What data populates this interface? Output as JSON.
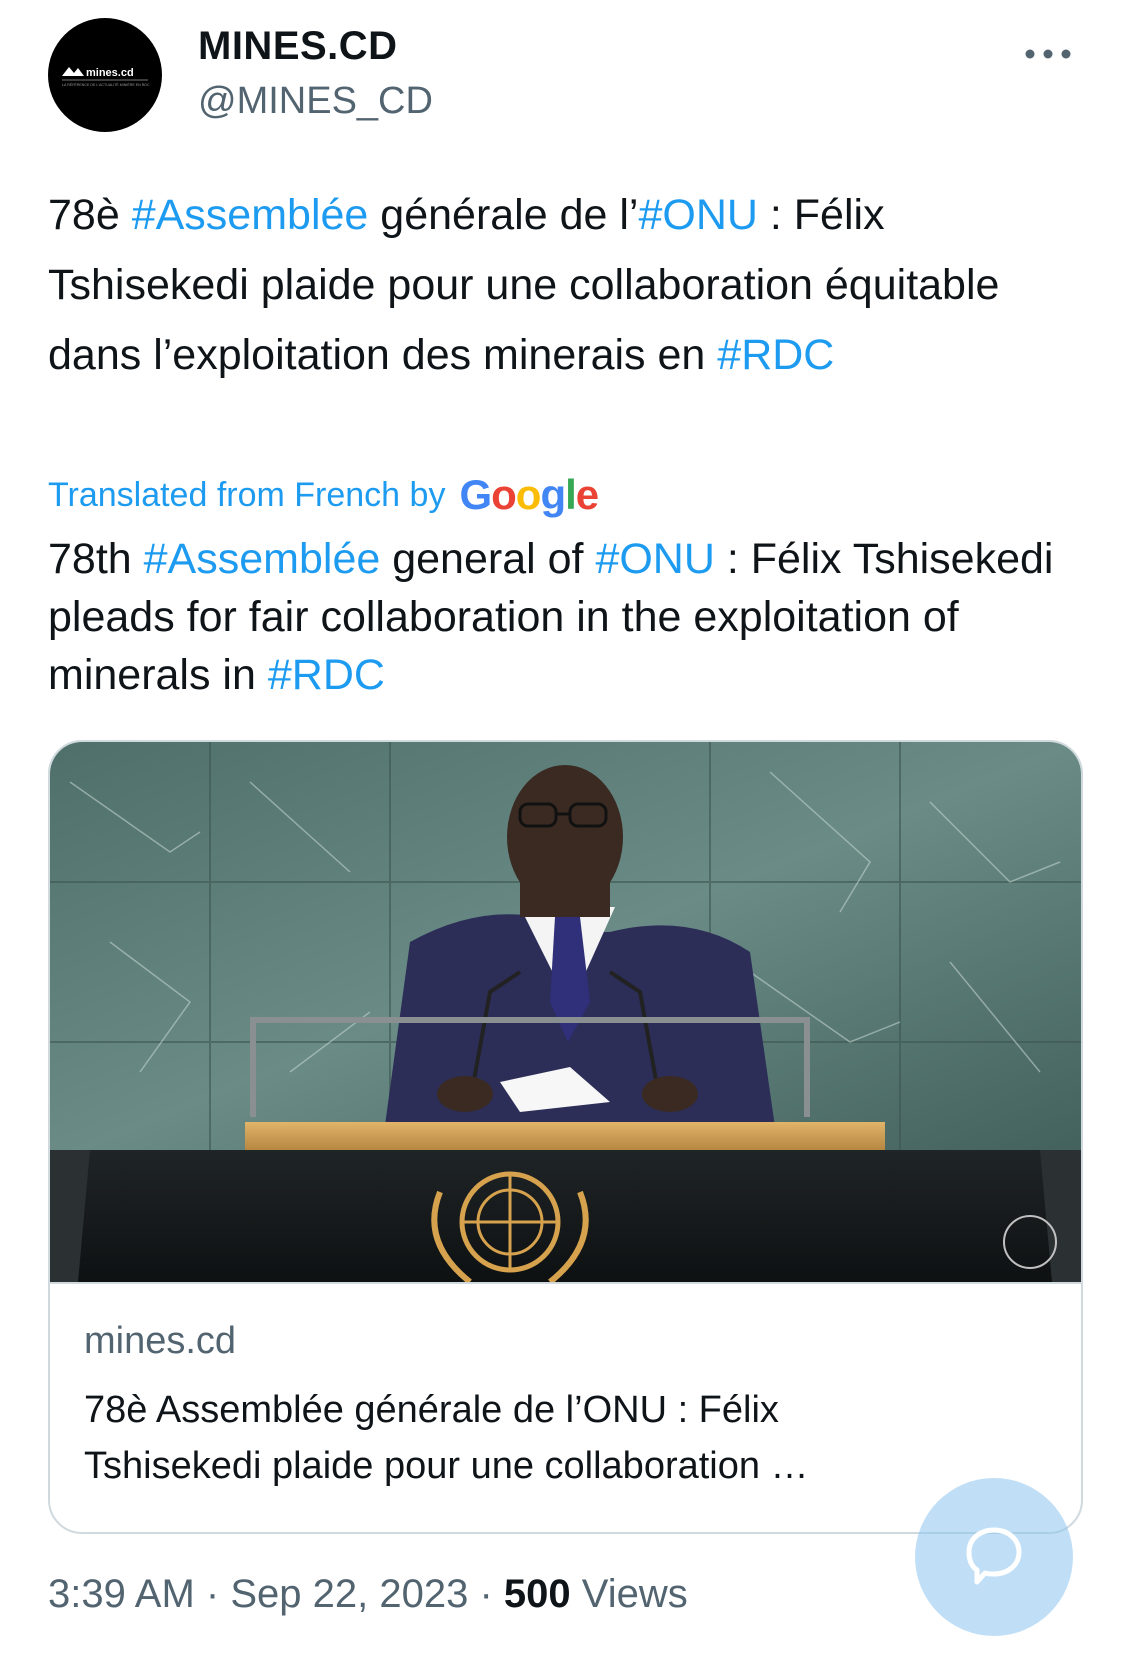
{
  "account": {
    "display_name": "MINES.CD",
    "handle": "@MINES_CD",
    "avatar_text": "mines.cd",
    "avatar_tagline": "LA RÉFÉRENCE DE L'ACTUALITÉ MINIÈRE EN RDC"
  },
  "tweet": {
    "original": {
      "t1": "78è ",
      "h1": "#Assemblée",
      "t2": " générale de l’",
      "h2": "#ONU",
      "t3": " : Félix Tshisekedi plaide pour une collaboration équitable dans l’exploitation des minerais en ",
      "h3": "#RDC"
    },
    "translated_label": "Translated from French by",
    "translator": "Google",
    "translation": {
      "t1": "78th ",
      "h1": "#Assemblée",
      "t2": " general of ",
      "h2": "#ONU",
      "t3": " : Félix Tshisekedi pleads for fair collaboration in the exploitation of minerals in ",
      "h3": "#RDC"
    }
  },
  "link_card": {
    "domain": "mines.cd",
    "title": "78è Assemblée générale de l’ONU : Félix Tshisekedi plaide pour une collaboration …",
    "image_icon": "photo-speaker-at-un-podium"
  },
  "footer": {
    "time": "3:39 AM",
    "separator": "·",
    "date": "Sep 22, 2023",
    "views_count": "500",
    "views_label": "Views"
  },
  "icons": {
    "more": "more-dots-icon",
    "compose": "reply-bubble-icon"
  },
  "colors": {
    "link": "#1d9bf0",
    "text": "#0f1419",
    "secondary": "#536471",
    "border": "#cfd9de"
  }
}
